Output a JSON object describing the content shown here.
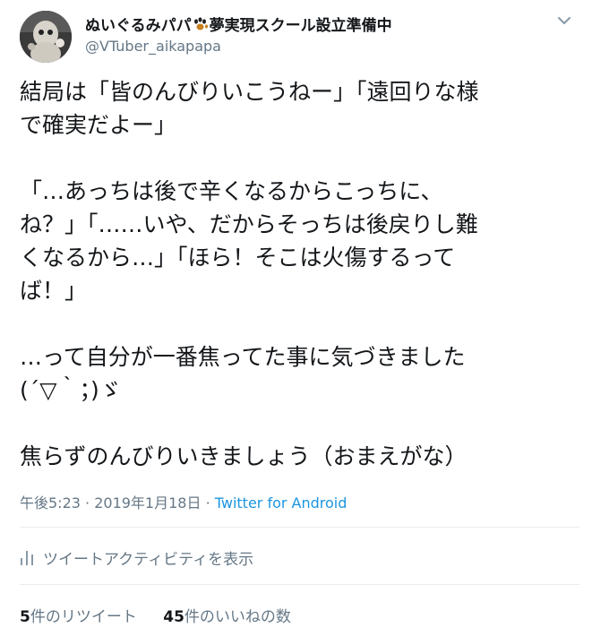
{
  "author": {
    "display_name": "ぬいぐるみパパ",
    "display_name_suffix": "夢実現スクール設立準備中",
    "name_emoji": "paw-prints-icon",
    "handle": "@VTuber_aikapapa",
    "avatar": "avatar-plush-doll"
  },
  "menu_icon": "chevron-down-icon",
  "tweet": {
    "paragraphs": [
      "結局は「皆のんびりいこうねー」「遠回りな様\nで確実だよー」",
      "「…あっちは後で辛くなるからこっちに、\nね？」「……いや、だからそっちは後戻りし難\nくなるから…」「ほら！そこは火傷するって\nば！」",
      "…って自分が一番焦ってた事に気づきました\n(´▽｀；)ゞ",
      "焦らずのんびりいきましょう（おまえがな）"
    ]
  },
  "meta": {
    "time": "午後5:23",
    "separator": "·",
    "date": "2019年1月18日",
    "source": "Twitter for Android"
  },
  "activity": {
    "label": "ツイートアクティビティを表示",
    "icon": "bar-chart-icon"
  },
  "stats": {
    "retweets_count": "5",
    "retweets_label": "件のリツイート",
    "likes_count": "45",
    "likes_label": "件のいいねの数"
  },
  "colors": {
    "text": "#14171a",
    "secondary": "#657786",
    "link": "#1b95e0",
    "divider": "#e6ecf0"
  }
}
